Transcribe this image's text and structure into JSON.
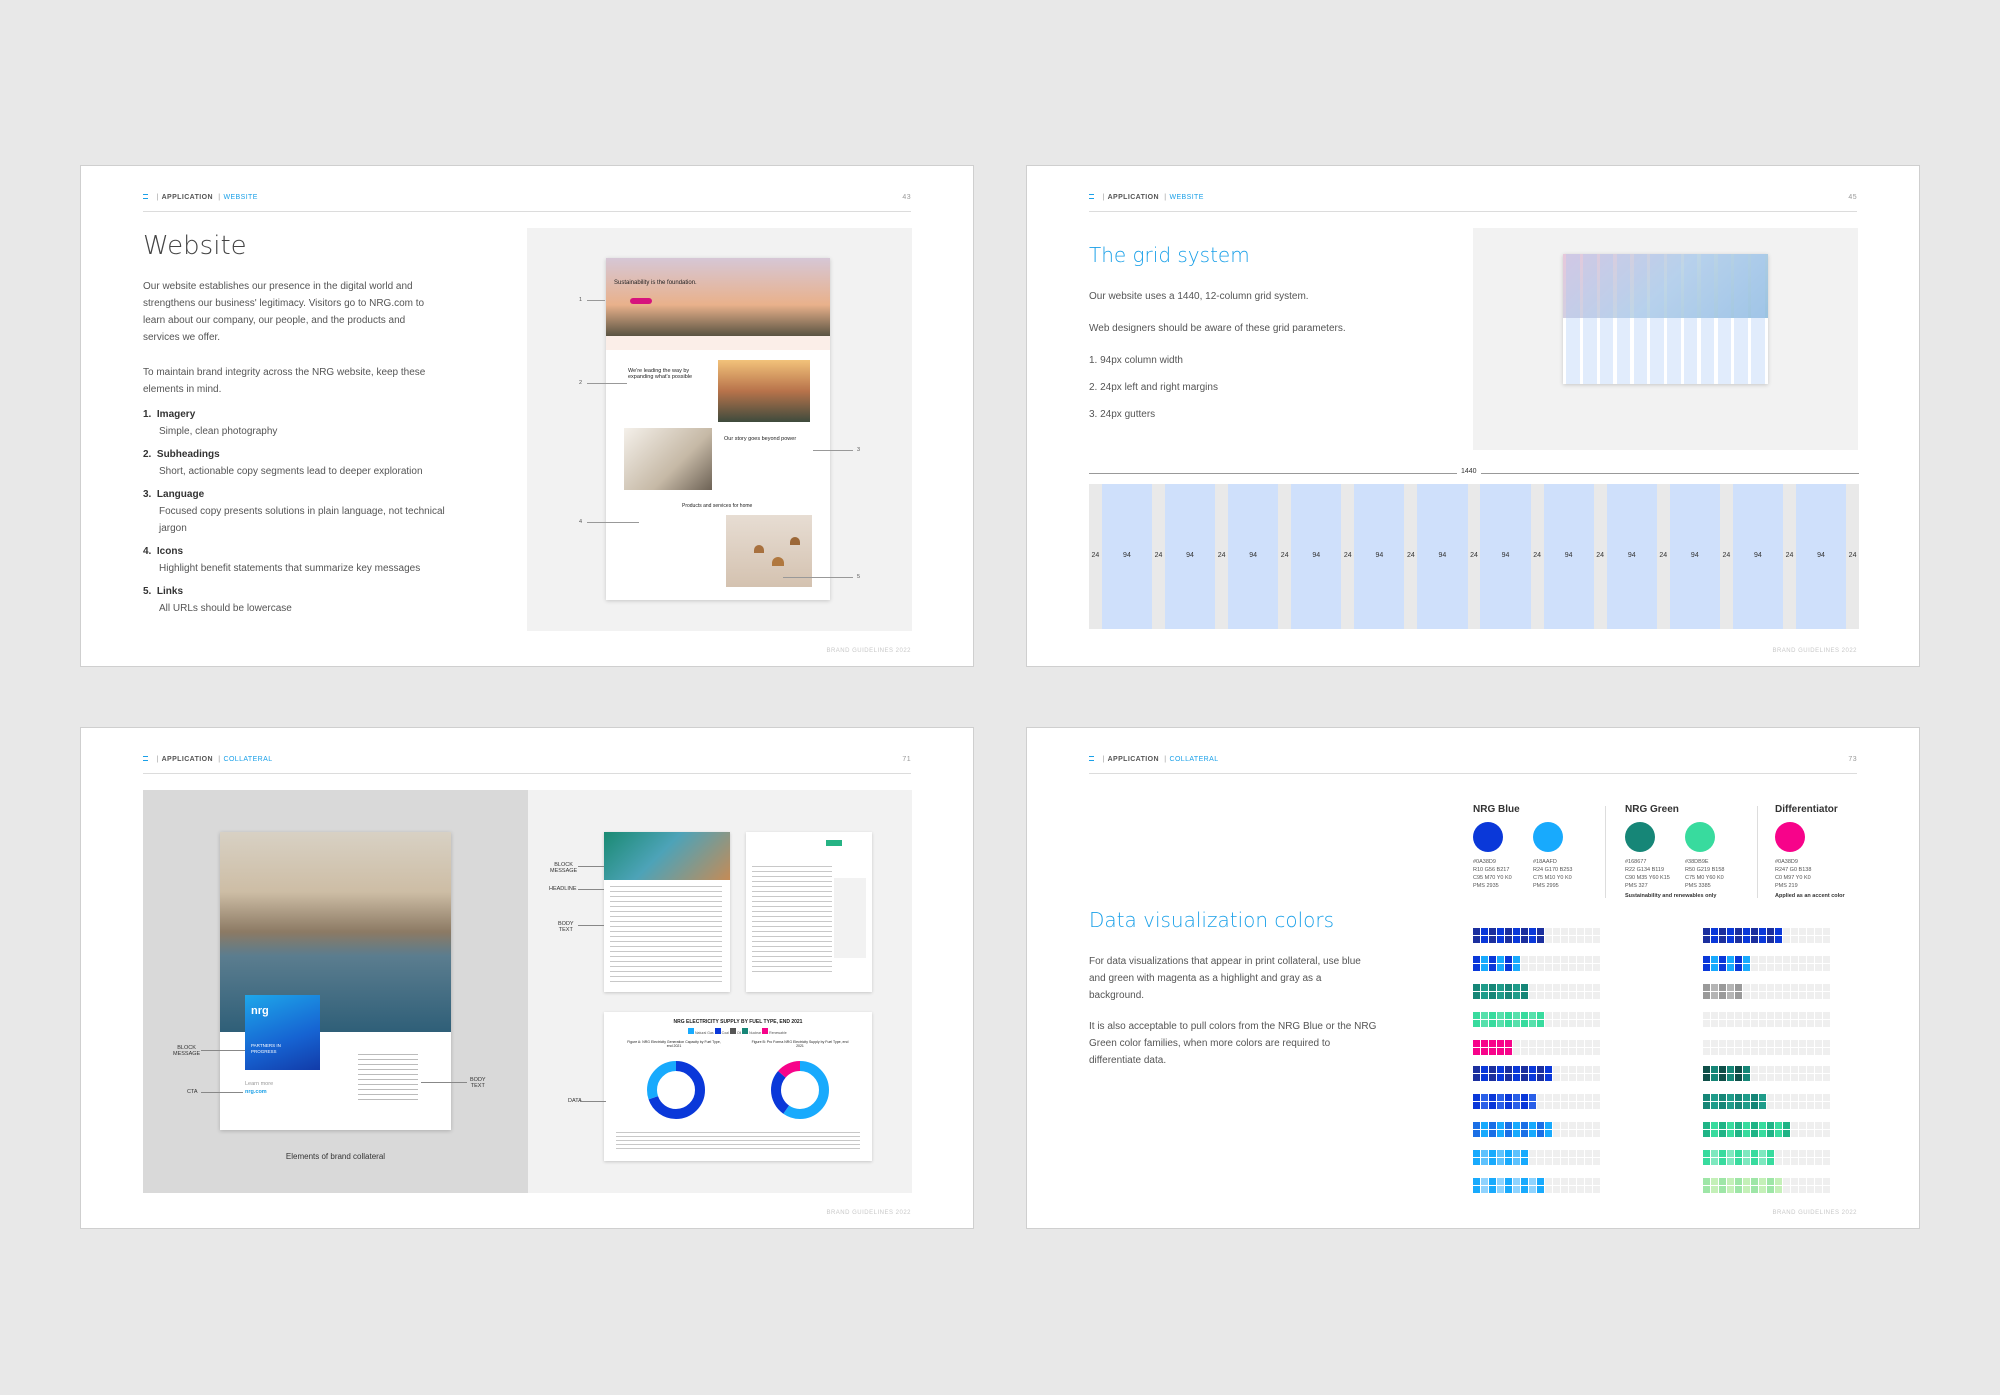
{
  "pages": [
    {
      "breadcrumb": {
        "section": "APPLICATION",
        "sub": "WEBSITE"
      },
      "page_number": "43",
      "footer": "BRAND GUIDELINES 2022",
      "title": "Website",
      "intro": "Our website establishes our presence in the digital world and strengthens our business' legitimacy. Visitors go to NRG.com to learn about our company, our people, and the products and services we offer.",
      "intro2": "To maintain brand integrity across the NRG website, keep these elements in mind.",
      "items": [
        {
          "num": "1.",
          "title": "Imagery",
          "desc": "Simple, clean photography"
        },
        {
          "num": "2.",
          "title": "Subheadings",
          "desc": "Short, actionable copy segments lead to deeper exploration"
        },
        {
          "num": "3.",
          "title": "Language",
          "desc": "Focused copy presents solutions in plain language, not technical jargon"
        },
        {
          "num": "4.",
          "title": "Icons",
          "desc": "Highlight benefit statements that summarize key messages"
        },
        {
          "num": "5.",
          "title": "Links",
          "desc": "All URLs should be lowercase"
        }
      ],
      "mock": {
        "hero": "Sustainability is the foundation.",
        "heading2": "We're leading the way by expanding what's possible",
        "heading3": "Our story goes beyond power",
        "heading4": "Products and services for home",
        "callouts": [
          "1",
          "2",
          "3",
          "4",
          "5"
        ]
      }
    },
    {
      "breadcrumb": {
        "section": "APPLICATION",
        "sub": "WEBSITE"
      },
      "page_number": "45",
      "footer": "BRAND GUIDELINES 2022",
      "title": "The grid system",
      "p1": "Our website uses a 1440, 12-column grid system.",
      "p2": "Web designers should be aware of these grid parameters.",
      "params": [
        "1.  94px column width",
        "2.  24px left and right margins",
        "3.  24px gutters"
      ],
      "grid_total": "1440",
      "gutter": "24",
      "column": "94"
    },
    {
      "breadcrumb": {
        "section": "APPLICATION",
        "sub": "COLLATERAL"
      },
      "page_number": "71",
      "footer": "BRAND GUIDELINES 2022",
      "caption": "Elements of brand collateral",
      "labels": {
        "block_message": "BLOCK\nMESSAGE",
        "cta": "CTA",
        "body_text": "BODY\nTEXT",
        "headline": "HEADLINE",
        "data": "DATA"
      },
      "brochure": {
        "logo": "nrg",
        "headline": "PARTNERS IN PROGRESS",
        "cta_label": "Learn more",
        "cta_url": "nrg.com"
      },
      "chart_sheet": {
        "title": "NRG ELECTRICITY SUPPLY BY FUEL TYPE, END 2021",
        "fig_a": "Figure A: NRG Electricity Generation Capacity by Fuel Type, end 2021",
        "fig_b": "Figure B: Pro Forma NRG Electricity Supply by Fuel Type, end 2021",
        "legend": [
          "Natural Gas",
          "Coal",
          "Oil",
          "Nuclear",
          "Renewable"
        ]
      }
    },
    {
      "breadcrumb": {
        "section": "APPLICATION",
        "sub": "COLLATERAL"
      },
      "page_number": "73",
      "footer": "BRAND GUIDELINES 2022",
      "title": "Data visualization colors",
      "p1": "For data visualizations that appear in print collateral, use blue and green with magenta as a highlight and gray as a background.",
      "p2": "It is also acceptable to pull colors from the NRG Blue or the NRG Green color families, when more colors are required to differentiate data.",
      "families": [
        {
          "name": "NRG Blue",
          "note": "",
          "colors": [
            {
              "hex": "#0A38D9",
              "spec": "#0A38D9\nR10 G56 B217\nC95 M70 Y0 K0\nPMS 2935"
            },
            {
              "hex": "#18AAFD",
              "spec": "#18AAFD\nR24 G170 B253\nC75 M10 Y0 K0\nPMS 2995"
            }
          ]
        },
        {
          "name": "NRG Green",
          "note": "Sustainability and renewables only",
          "colors": [
            {
              "hex": "#168677",
              "spec": "#168677\nR22 G134 B119\nC90 M35 Y60 K15\nPMS 327"
            },
            {
              "hex": "#38DB9E",
              "spec": "#38DB9E\nR50 G219 B158\nC75 M0 Y60 K0\nPMS 3385"
            }
          ]
        },
        {
          "name": "Differentiator",
          "note": "Applied as an accent color",
          "colors": [
            {
              "hex": "#F7038A",
              "spec": "#0A38D9\nR247 G0 B138\nC0 M97 Y0 K0\nPMS 219"
            }
          ]
        }
      ]
    }
  ],
  "colors": {
    "accent": "#1aa0e8",
    "grid_col": "#cfe0fb",
    "grid_gut": "#e9e9e9"
  }
}
